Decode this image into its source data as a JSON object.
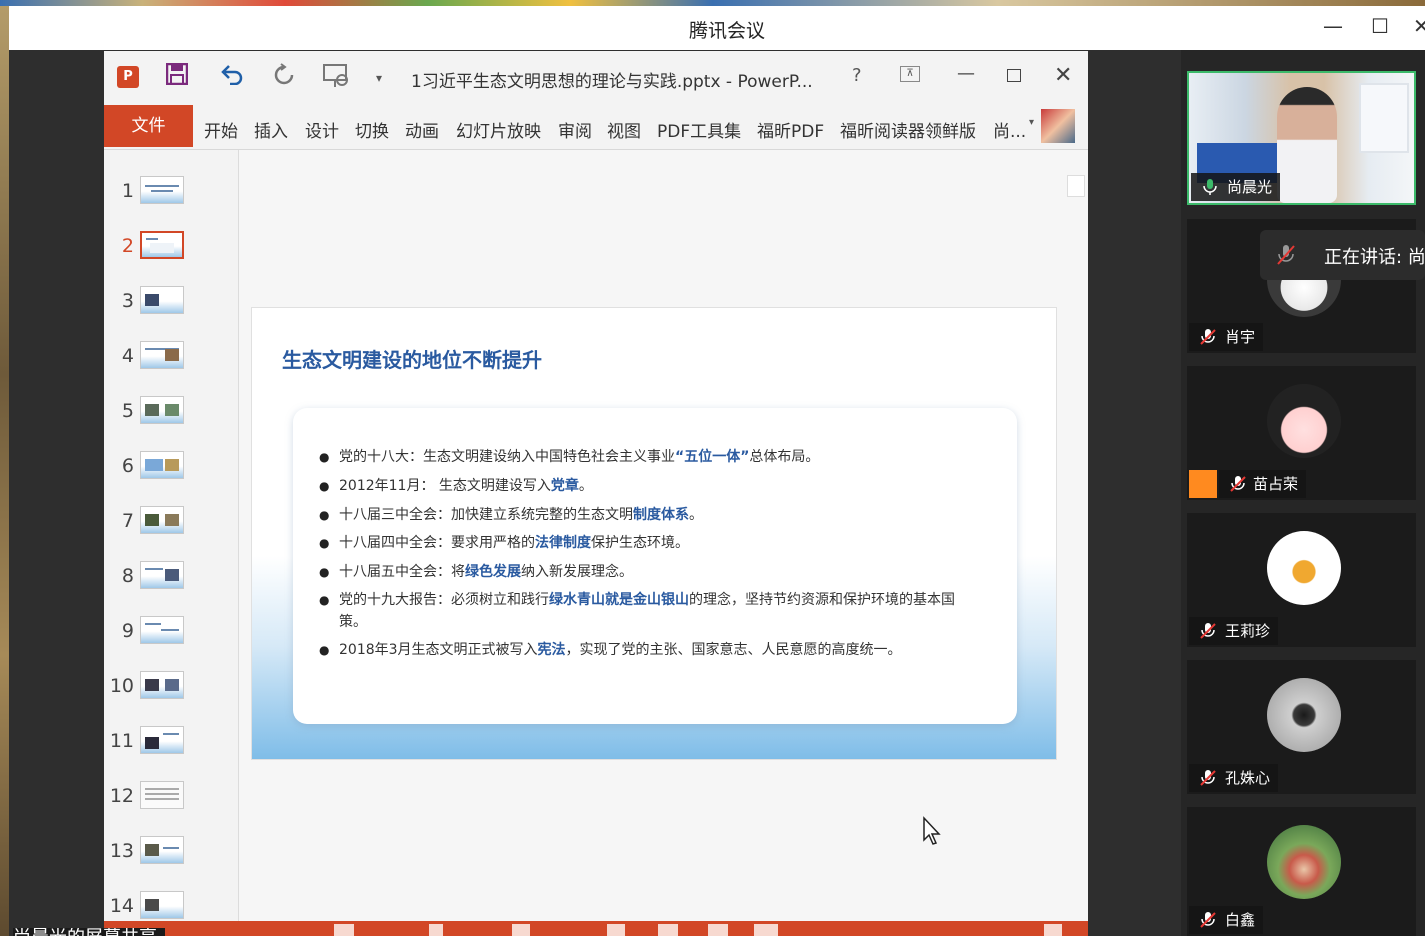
{
  "meeting": {
    "title": "腾讯会议",
    "minimize": "—",
    "maximize": "☐",
    "close": "✕",
    "bottom_label": "尚晨光的屏幕共享"
  },
  "ppt": {
    "doc_title": "1习近平生态文明思想的理论与实践.pptx - PowerP...",
    "help": "?",
    "ribbon_display": "⊼",
    "logo": "P",
    "file_tab": "文件",
    "tabs": [
      "开始",
      "插入",
      "设计",
      "切换",
      "动画",
      "幻灯片放映",
      "审阅",
      "视图",
      "PDF工具集",
      "福昕PDF",
      "福昕阅读器领鲜版",
      "尚..."
    ],
    "thumbnails": [
      "1",
      "2",
      "3",
      "4",
      "5",
      "6",
      "7",
      "8",
      "9",
      "10",
      "11",
      "12",
      "13",
      "14"
    ],
    "active_slide": "2"
  },
  "slide": {
    "title": "生态文明建设的地位不断提升",
    "bullets": [
      {
        "parts": [
          [
            "党的十八大：生态文明建设纳入中国特色社会主义事业",
            false
          ],
          [
            "“五位一体”",
            true
          ],
          [
            "总体布局。",
            false
          ]
        ]
      },
      {
        "parts": [
          [
            "2012年11月： 生态文明建设写入",
            false
          ],
          [
            "党章",
            true
          ],
          [
            "。",
            false
          ]
        ]
      },
      {
        "parts": [
          [
            "十八届三中全会：加快建立系统完整的生态文明",
            false
          ],
          [
            "制度体系",
            true
          ],
          [
            "。",
            false
          ]
        ]
      },
      {
        "parts": [
          [
            "十八届四中全会：要求用严格的",
            false
          ],
          [
            "法律制度",
            true
          ],
          [
            "保护生态环境。",
            false
          ]
        ]
      },
      {
        "parts": [
          [
            "十八届五中全会：将",
            false
          ],
          [
            "绿色发展",
            true
          ],
          [
            "纳入新发展理念。",
            false
          ]
        ]
      },
      {
        "parts": [
          [
            "党的十九大报告：必须树立和践行",
            false
          ],
          [
            "绿水青山就是金山银山",
            true
          ],
          [
            "的理念，坚持节约资源和保护环境的基本国策。",
            false
          ]
        ]
      },
      {
        "parts": [
          [
            "2018年3月生态文明正式被写入",
            false
          ],
          [
            "宪法",
            true
          ],
          [
            "，实现了党的主张、国家意志、人民意愿的高度统一。",
            false
          ]
        ]
      }
    ]
  },
  "participants": [
    {
      "name": "尚晨光",
      "muted": false
    },
    {
      "name": "肖宇",
      "muted": true
    },
    {
      "name": "苗占荣",
      "muted": true
    },
    {
      "name": "王莉珍",
      "muted": true
    },
    {
      "name": "孔姝心",
      "muted": true
    },
    {
      "name": "白鑫",
      "muted": true
    }
  ],
  "speaking": {
    "text": "正在讲话: 尚"
  },
  "colors": {
    "ppt_accent": "#d24726",
    "slide_title": "#2a5aa0",
    "active_border": "#3cba6a"
  }
}
